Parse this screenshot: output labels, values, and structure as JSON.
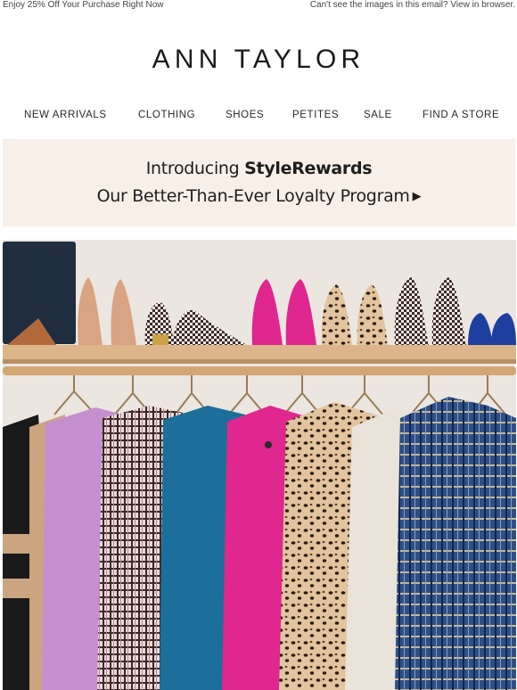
{
  "preheader": {
    "left_text": "Enjoy 25% Off Your Purchase Right Now",
    "right_text": "Can't see the images in this email? View in browser."
  },
  "brand": {
    "logo_text": "ANN TAYLOR"
  },
  "nav": {
    "items": [
      {
        "label": "NEW ARRIVALS"
      },
      {
        "label": "CLOTHING"
      },
      {
        "label": "SHOES"
      },
      {
        "label": "PETITES"
      },
      {
        "label": "SALE"
      },
      {
        "label": "FIND A STORE"
      }
    ]
  },
  "promo": {
    "intro": "Introducing ",
    "program_name": "StyleRewards",
    "tagline": "Our Better-Than-Ever Loyalty Program",
    "arrow_icon": "play-arrow-icon",
    "background": "#f7efe8"
  },
  "hero": {
    "description_icon": "closet-shoes-and-jackets-image",
    "colors": {
      "wall": "#e9e4de",
      "shelf": "#d9b48a",
      "rail": "#c89a68",
      "pink": "#e0268f",
      "lilac": "#c58fd0",
      "teal": "#1b6f9a",
      "navy": "#1d3f7a",
      "cream": "#e9e3da",
      "camel": "#c9a27c"
    }
  }
}
